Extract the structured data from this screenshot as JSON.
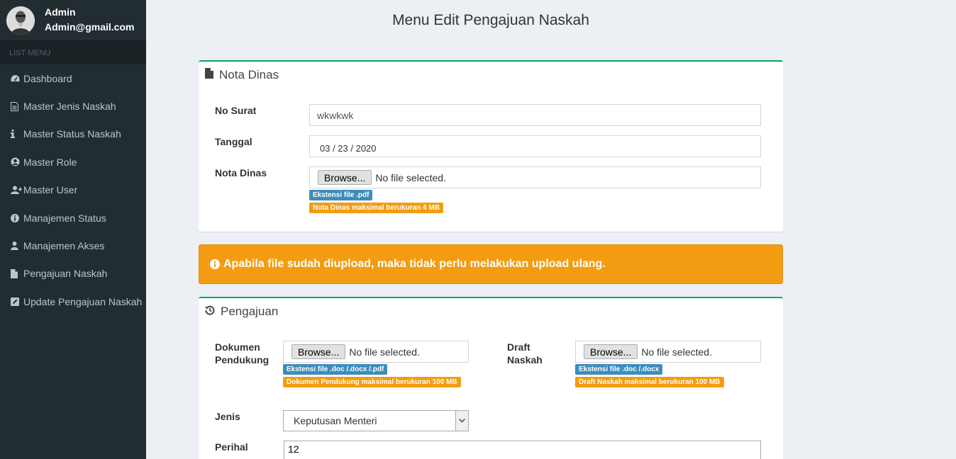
{
  "user": {
    "name": "Admin",
    "email": "Admin@gmail.com"
  },
  "sidebar": {
    "header": "LIST MENU",
    "items": [
      {
        "label": "Dashboard",
        "icon": "dashboard-icon"
      },
      {
        "label": "Master Jenis Naskah",
        "icon": "file-text-icon"
      },
      {
        "label": "Master Status Naskah",
        "icon": "info-icon"
      },
      {
        "label": "Master Role",
        "icon": "user-circle-icon"
      },
      {
        "label": "Master User",
        "icon": "user-plus-icon"
      },
      {
        "label": "Manajemen Status",
        "icon": "info-circle-icon"
      },
      {
        "label": "Manajemen Akses",
        "icon": "user-icon"
      },
      {
        "label": "Pengajuan Naskah",
        "icon": "file-icon"
      },
      {
        "label": "Update Pengajuan Naskah",
        "icon": "edit-icon"
      }
    ]
  },
  "page": {
    "title": "Menu Edit Pengajuan Naskah"
  },
  "nota_dinas": {
    "title": "Nota Dinas",
    "no_surat_label": "No Surat",
    "no_surat_value": "wkwkwk",
    "tanggal_label": "Tanggal",
    "tanggal_value": "03 / 23 / 2020",
    "file_label": "Nota Dinas",
    "browse_label": "Browse...",
    "file_status": "No file selected.",
    "badge_ext": "Ekstensi file .pdf",
    "badge_size": "Nota Dinas maksimal berukuran 4 MB"
  },
  "alert": {
    "text": "Apabila file sudah diupload, maka tidak perlu melakukan upload ulang."
  },
  "pengajuan": {
    "title": "Pengajuan",
    "dokumen_label_1": "Dokumen",
    "dokumen_label_2": "Pendukung",
    "dokumen_browse": "Browse...",
    "dokumen_status": "No file selected.",
    "dokumen_badge_ext": "Ekstensi file .doc /.docx /.pdf",
    "dokumen_badge_size": "Dokumen Pendukung maksimal berukuran 100 MB",
    "draft_label_1": "Draft",
    "draft_label_2": "Naskah",
    "draft_browse": "Browse...",
    "draft_status": "No file selected.",
    "draft_badge_ext": "Ekstensi file .doc /.docx",
    "draft_badge_size": "Draft Naskah maksimal berukuran 100 MB",
    "jenis_label": "Jenis",
    "jenis_value": "Keputusan Menteri",
    "perihal_label": "Perihal",
    "perihal_value": "12"
  },
  "colors": {
    "sidebar_bg": "#222d32",
    "accent_green": "#00a65a",
    "warning": "#f39c12",
    "info": "#3c8dbc"
  }
}
